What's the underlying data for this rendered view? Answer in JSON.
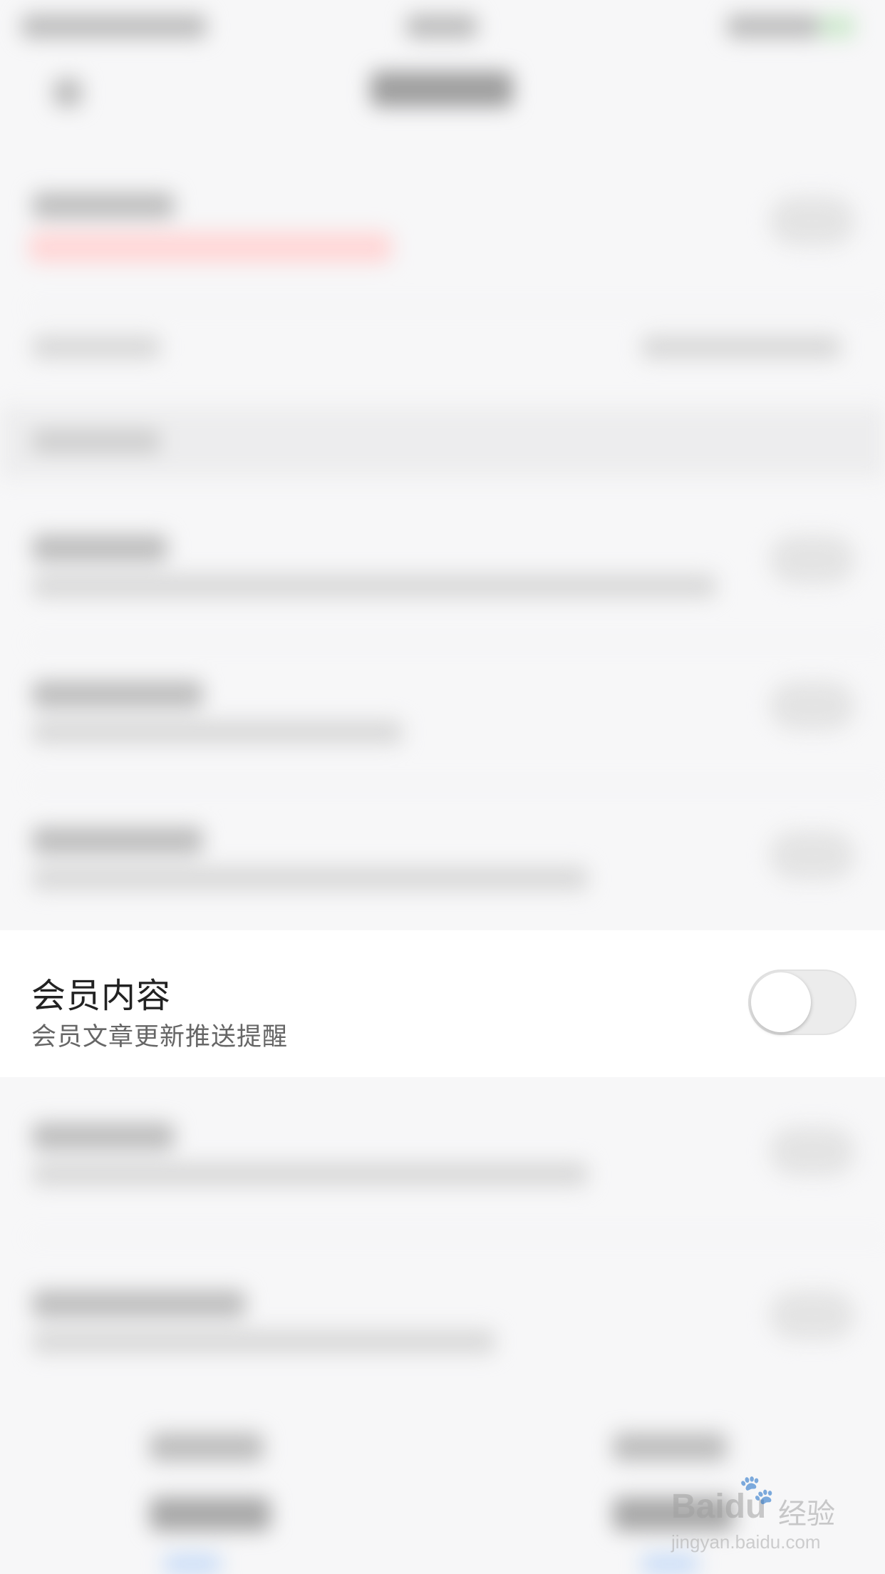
{
  "membership_row": {
    "title": "会员内容",
    "subtitle": "会员文章更新推送提醒",
    "toggle_on": false
  },
  "watermark": {
    "brand": "Baidu",
    "brand_cn": "经验",
    "url": "jingyan.baidu.com"
  },
  "colors": {
    "background": "#f7f7f8",
    "row_background": "#ffffff",
    "title_text": "#222222",
    "subtitle_text": "#666666",
    "toggle_track": "#ececec",
    "toggle_knob": "#ffffff"
  }
}
